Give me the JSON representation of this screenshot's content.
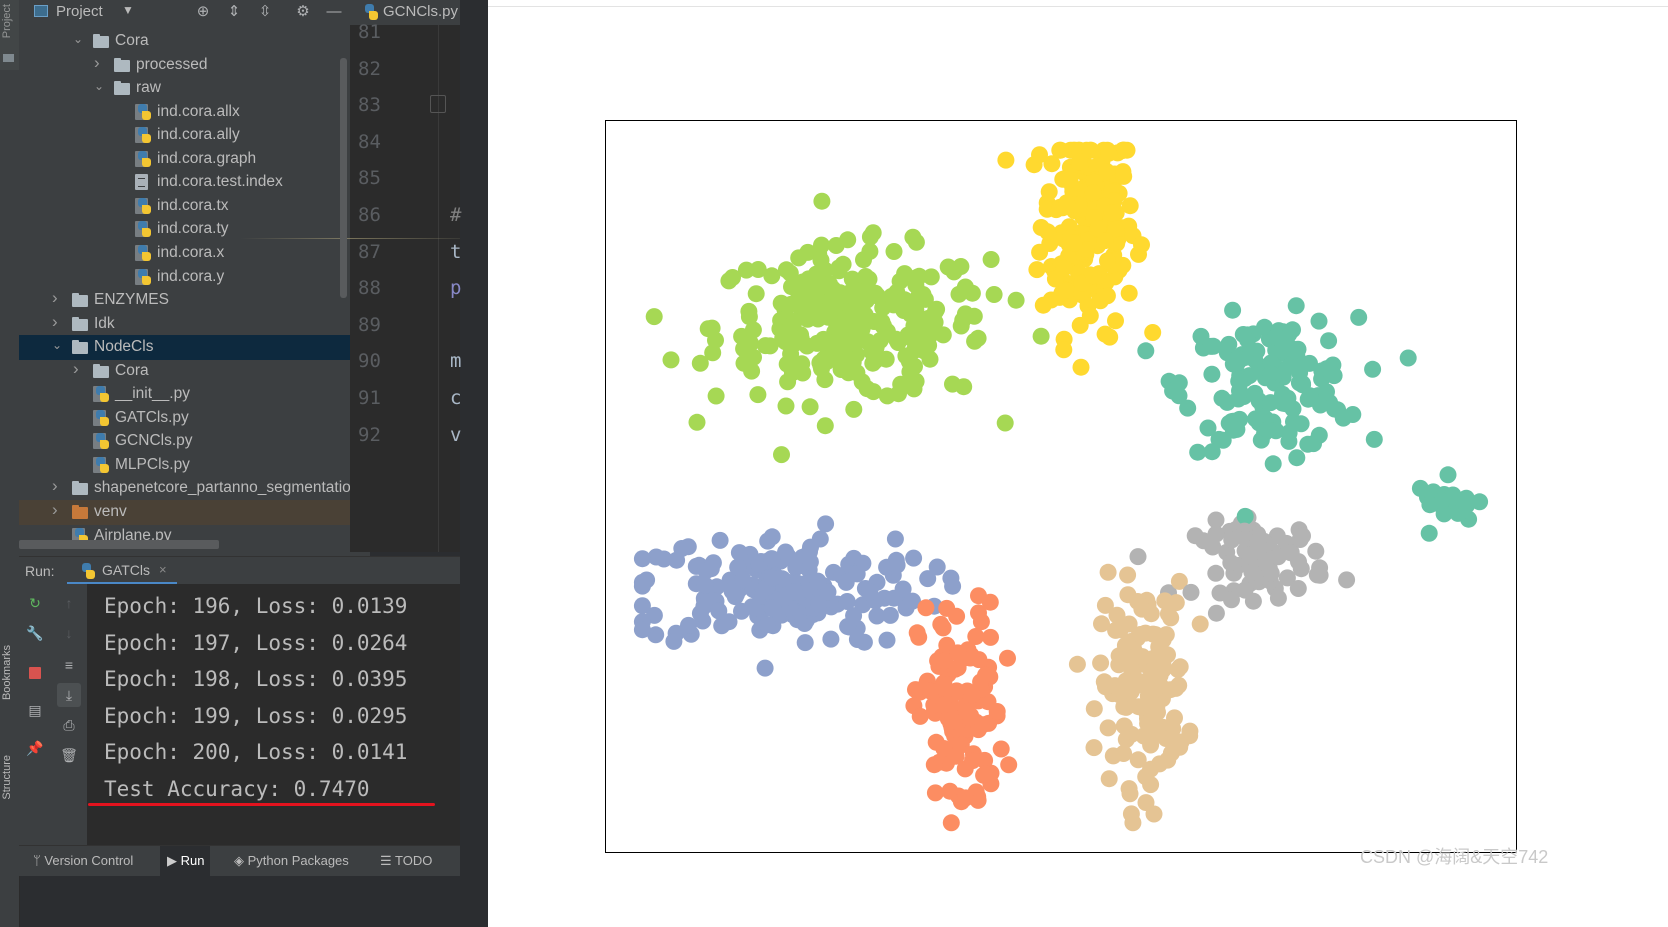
{
  "project_toolbar": {
    "title": "Project"
  },
  "editor_tab": {
    "filename": "GCNCls.py"
  },
  "sidebar_labels": {
    "project": "Project",
    "bookmarks": "Bookmarks",
    "structure": "Structure"
  },
  "tree": [
    {
      "label": "Cora",
      "type": "folder",
      "depth": 2,
      "expanded": true
    },
    {
      "label": "processed",
      "type": "folder",
      "depth": 3,
      "expanded": false
    },
    {
      "label": "raw",
      "type": "folder",
      "depth": 3,
      "expanded": true
    },
    {
      "label": "ind.cora.allx",
      "type": "pyfile",
      "depth": 4
    },
    {
      "label": "ind.cora.ally",
      "type": "pyfile",
      "depth": 4
    },
    {
      "label": "ind.cora.graph",
      "type": "pyfile",
      "depth": 4
    },
    {
      "label": "ind.cora.test.index",
      "type": "textfile",
      "depth": 4
    },
    {
      "label": "ind.cora.tx",
      "type": "pyfile",
      "depth": 4
    },
    {
      "label": "ind.cora.ty",
      "type": "pyfile",
      "depth": 4
    },
    {
      "label": "ind.cora.x",
      "type": "pyfile",
      "depth": 4
    },
    {
      "label": "ind.cora.y",
      "type": "pyfile",
      "depth": 4
    },
    {
      "label": "ENZYMES",
      "type": "folder",
      "depth": 1,
      "expanded": false
    },
    {
      "label": "Idk",
      "type": "folder",
      "depth": 1,
      "expanded": false
    },
    {
      "label": "NodeCls",
      "type": "folder",
      "depth": 1,
      "expanded": true,
      "selected": true
    },
    {
      "label": "Cora",
      "type": "folder",
      "depth": 2,
      "expanded": false
    },
    {
      "label": "__init__.py",
      "type": "pyfile",
      "depth": 2
    },
    {
      "label": "GATCls.py",
      "type": "pyfile",
      "depth": 2
    },
    {
      "label": "GCNCls.py",
      "type": "pyfile",
      "depth": 2
    },
    {
      "label": "MLPCls.py",
      "type": "pyfile",
      "depth": 2
    },
    {
      "label": "shapenetcore_partanno_segmentation",
      "type": "folder",
      "depth": 1,
      "expanded": false
    },
    {
      "label": "venv",
      "type": "folder-excluded",
      "depth": 1,
      "expanded": false
    },
    {
      "label": "Airplane.py",
      "type": "pyfile",
      "depth": 1
    }
  ],
  "editor": {
    "line_numbers": [
      "81",
      "82",
      "83",
      "84",
      "85",
      "86",
      "87",
      "88",
      "89",
      "90",
      "91",
      "92"
    ],
    "fragments": [
      {
        "line": "86",
        "text": "#",
        "color": "#808080"
      },
      {
        "line": "87",
        "text": "t",
        "color": "#a9b7c6"
      },
      {
        "line": "88",
        "text": "p",
        "color": "#8888c6"
      },
      {
        "line": "90",
        "text": "m",
        "color": "#a9b7c6"
      },
      {
        "line": "91",
        "text": "c",
        "color": "#a9b7c6"
      },
      {
        "line": "92",
        "text": "v",
        "color": "#a9b7c6"
      }
    ]
  },
  "run_panel": {
    "label": "Run:",
    "tab": "GATCls",
    "console_lines": [
      "Epoch: 196, Loss: 0.0139",
      "Epoch: 197, Loss: 0.0264",
      "Epoch: 198, Loss: 0.0395",
      "Epoch: 199, Loss: 0.0295",
      "Epoch: 200, Loss: 0.0141",
      "Test Accuracy: 0.7470"
    ],
    "highlight_color": "#e3131e"
  },
  "status_bar": {
    "items": [
      "Version Control",
      "Run",
      "Python Packages",
      "TODO"
    ]
  },
  "chart_data": {
    "type": "scatter",
    "title": "",
    "xlabel": "",
    "ylabel": "",
    "axes_shown": false,
    "grid": false,
    "xlim": [
      0,
      100
    ],
    "ylim": [
      0,
      100
    ],
    "clusters": [
      {
        "color": "#ffd92f",
        "center": [
          53,
          86
        ],
        "spread": [
          2.6,
          7.5
        ],
        "count": 200
      },
      {
        "color": "#a6d854",
        "center": [
          27,
          72
        ],
        "spread": [
          7.5,
          5.2
        ],
        "count": 260
      },
      {
        "color": "#66c2a5",
        "center": [
          73,
          64
        ],
        "spread": [
          4.8,
          4.5
        ],
        "count": 140
      },
      {
        "color": "#8da0cb",
        "center": [
          19,
          36
        ],
        "spread": [
          8.0,
          3.8
        ],
        "count": 190
      },
      {
        "color": "#fc8d62",
        "center": [
          39,
          19
        ],
        "spread": [
          2.3,
          7.5
        ],
        "count": 120
      },
      {
        "color": "#e5c494",
        "center": [
          59,
          23
        ],
        "spread": [
          2.4,
          6.8
        ],
        "count": 140
      },
      {
        "color": "#b3b3b3",
        "center": [
          72,
          40
        ],
        "spread": [
          3.6,
          2.6
        ],
        "count": 70
      },
      {
        "color": "#66c2a5",
        "center": [
          93,
          48
        ],
        "spread": [
          2.0,
          1.5
        ],
        "count": 20
      }
    ],
    "point_radius": 8.5
  },
  "watermark": "CSDN @海阔&天空742"
}
